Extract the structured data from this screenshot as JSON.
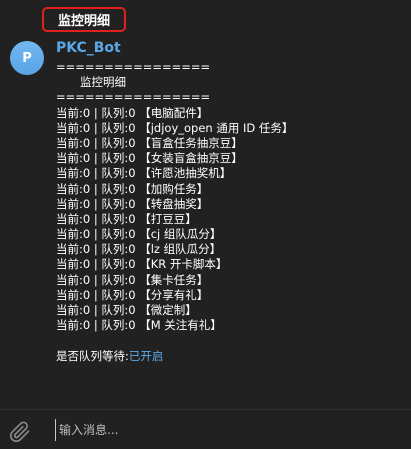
{
  "header": {
    "title": "监控明细"
  },
  "message": {
    "avatar_letter": "P",
    "sender": "PKC_Bot",
    "separator": "================",
    "heading": "监控明细",
    "tasks": [
      "当前:0 | 队列:0 【电脑配件】",
      "当前:0 | 队列:0 【jdjoy_open 通用 ID 任务】",
      "当前:0 | 队列:0 【盲盒任务抽京豆】",
      "当前:0 | 队列:0 【女装盲盒抽京豆】",
      "当前:0 | 队列:0 【许愿池抽奖机】",
      "当前:0 | 队列:0 【加购任务】",
      "当前:0 | 队列:0 【转盘抽奖】",
      "当前:0 | 队列:0 【打豆豆】",
      "当前:0 | 队列:0 【cj 组队瓜分】",
      "当前:0 | 队列:0 【lz 组队瓜分】",
      "当前:0 | 队列:0 【KR 开卡脚本】",
      "当前:0 | 队列:0 【集卡任务】",
      "当前:0 | 队列:0 【分享有礼】",
      "当前:0 | 队列:0 【微定制】",
      "当前:0 | 队列:0 【M 关注有礼】"
    ],
    "queue_wait_label": "是否队列等待:",
    "queue_wait_value": "已开启"
  },
  "composer": {
    "placeholder": "输入消息...",
    "attach_icon": "paperclip-icon"
  },
  "colors": {
    "background": "#212121",
    "accent": "#5ba8e8",
    "highlight_border": "#e0201c"
  }
}
